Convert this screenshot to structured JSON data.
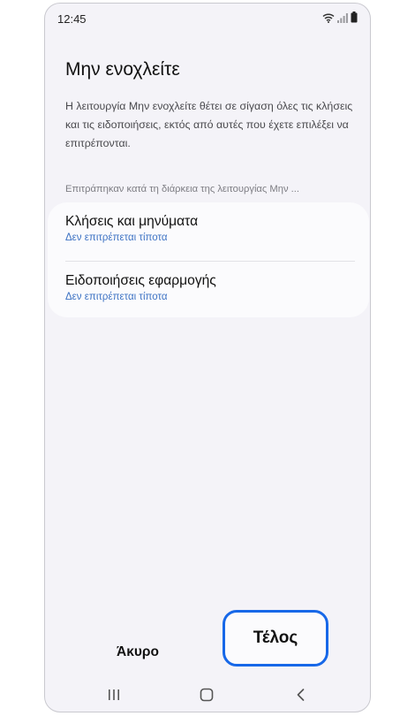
{
  "status_bar": {
    "time": "12:45",
    "icons": [
      "wifi-icon",
      "signal-icon",
      "battery-icon"
    ]
  },
  "page": {
    "title": "Μην ενοχλείτε",
    "description": "Η λειτουργία Μην ενοχλείτε θέτει σε σίγαση όλες τις κλήσεις και τις ειδοποιήσεις, εκτός από αυτές που έχετε επιλέξει να επιτρέπονται.",
    "section_label": "Επιτράπηκαν κατά τη διάρκεια της λειτουργίας Μην ..."
  },
  "items": [
    {
      "title": "Κλήσεις και μηνύματα",
      "subtitle": "Δεν επιτρέπεται τίποτα"
    },
    {
      "title": "Ειδοποιήσεις εφαρμογής",
      "subtitle": "Δεν επιτρέπεται τίποτα"
    }
  ],
  "actions": {
    "cancel_label": "Άκυρο",
    "done_label": "Τέλος"
  },
  "colors": {
    "background": "#f4f3f8",
    "card": "#fbfbfd",
    "link_blue": "#3e73c4",
    "highlight_blue": "#1768e8"
  },
  "nav_bar": {
    "icons": [
      "recents-icon",
      "home-icon",
      "back-icon"
    ]
  }
}
